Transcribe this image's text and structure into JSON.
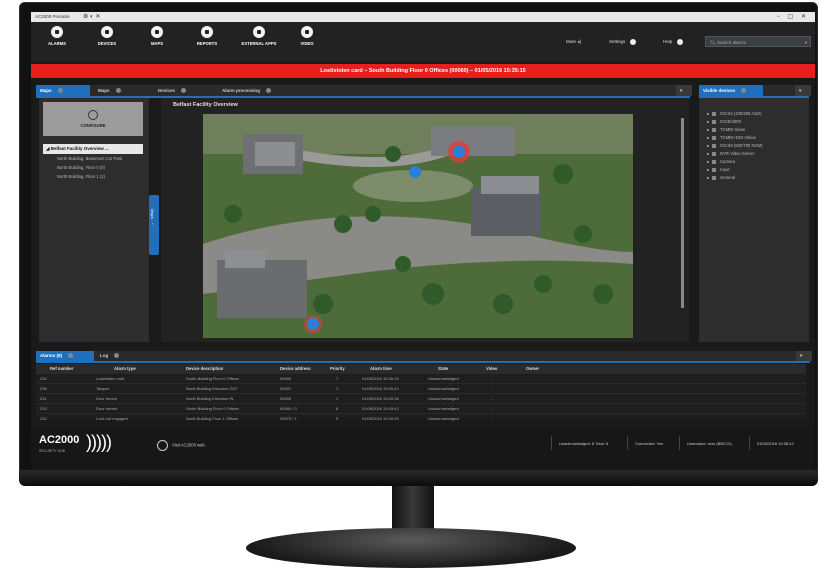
{
  "window": {
    "title": "AC2000 Pinnacle",
    "controls": "− ▢ ✕"
  },
  "toolbar": {
    "tools": [
      {
        "label": "ALARMS",
        "icon": "alarm-icon"
      },
      {
        "label": "DEVICES",
        "icon": "device-icon"
      },
      {
        "label": "MAPS",
        "icon": "map-icon"
      },
      {
        "label": "REPORTS",
        "icon": "report-icon"
      },
      {
        "label": "EXTERNAL APPS",
        "icon": "apps-icon"
      },
      {
        "label": "VIDEO",
        "icon": "video-icon"
      }
    ],
    "mute": "Mute",
    "settings": "Settings",
    "help": "Help",
    "search_placeholder": "Search alarms"
  },
  "banner": {
    "text": "Lost/stolen card  –  South Building Floor 0 Offices (00060)  –  01/05/2016 15:35:15",
    "color": "#e61e1e"
  },
  "main_tabs": [
    {
      "label": "Maps",
      "active": true
    },
    {
      "label": "Maps",
      "active": false
    },
    {
      "label": "Devices",
      "active": false
    },
    {
      "label": "Alarm processing",
      "active": false
    }
  ],
  "left": {
    "configure_label": "CONFIGURE",
    "tree_root": "Belfast Facility Overview ...",
    "tree_children": [
      "North Building, Basement Car Park",
      "North Building, Floor 0 (0)",
      "North Building, Floor 1 (1)"
    ],
    "handle_label": "Maps"
  },
  "map": {
    "title": "Belfast Facility Overview"
  },
  "right": {
    "tab_label": "Visible devices",
    "devices": [
      "IOCS4 (100/200 A&O)",
      "IOCB/4009",
      "TCMDI-Slave",
      "TCMDI+DIO+Slave",
      "IOCS8 (500/700 NOM)",
      "DVR Video Server",
      "Camera",
      "Input",
      "General"
    ]
  },
  "bottom": {
    "tabs": [
      {
        "label": "Alarms (8)",
        "active": true
      },
      {
        "label": "Log",
        "active": false
      }
    ],
    "columns": [
      "Ref number",
      "Alarm type",
      "Device description",
      "Device address",
      "Priority",
      "Alarm time",
      "State",
      "Video",
      "Owner"
    ],
    "rows": [
      [
        "234",
        "Lost/stolen card",
        "South Building Floor 0 Offices",
        "00060",
        "7",
        "01/05/2016 15:35:15",
        "Unacknowledged",
        "-",
        ""
      ],
      [
        "236",
        "Tamper",
        "North Building Entrance OUT",
        "00001",
        "1",
        "01/05/2016 15:05:42",
        "Unacknowledged",
        "-",
        ""
      ],
      [
        "231",
        "Door forced",
        "North Building Entrance IN",
        "00000",
        "1",
        "01/05/2016 15:03:36",
        "Unacknowledged",
        "-",
        ""
      ],
      [
        "233",
        "Door forced",
        "South Building Floor 0 Offices",
        "00060 / 3",
        "8",
        "01/05/2016 15:03:42",
        "Unacknowledged",
        "-",
        ""
      ],
      [
        "232",
        "Lock not engaged",
        "North Building Floor 1 Offices",
        "00075 / 1",
        "9",
        "01/05/2016 15:04:49",
        "Unacknowledged",
        "-",
        ""
      ]
    ]
  },
  "status": {
    "brand": "AC2000",
    "brand_sub": "SECURITY HUB",
    "waves": ")))))",
    "visit": "Visit AC2000 web",
    "unack": "Unacknowledged: 8  Total: 8",
    "connected": "Connected: Yes",
    "user": "Username: cem (BBC10)",
    "datetime": "01/05/2016 15:38:42"
  }
}
